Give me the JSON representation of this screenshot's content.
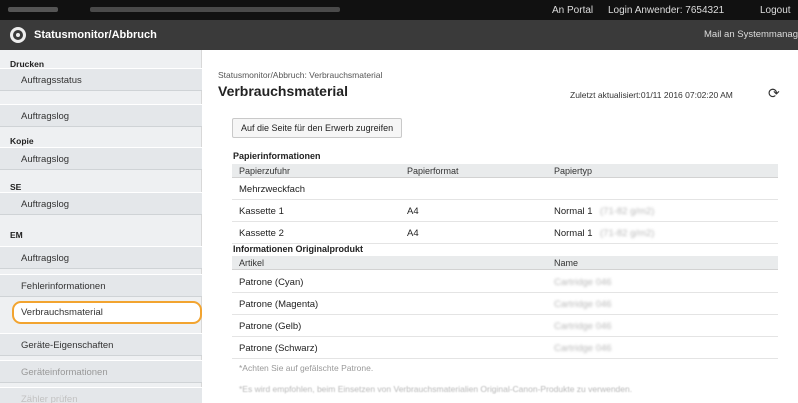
{
  "topbar": {
    "portal": "An Portal",
    "login": "Login Anwender:  7654321",
    "logout": "Logout"
  },
  "header": {
    "title": "Statusmonitor/Abbruch",
    "mail": "Mail an Systemmanager"
  },
  "sidebar": {
    "sections": [
      {
        "label": "Drucken",
        "items": [
          "Auftragsstatus",
          "Auftragslog"
        ]
      },
      {
        "label": "Kopie",
        "items": [
          "Auftragslog"
        ]
      },
      {
        "label": "SE",
        "items": [
          "Auftragslog"
        ]
      },
      {
        "label": "EM",
        "items": [
          "Auftragslog"
        ]
      }
    ],
    "extra_items": [
      "Fehlerinformationen",
      "Verbrauchsmaterial",
      "Geräte-Eigenschaften",
      "Geräteinformationen",
      "Zähler prüfen"
    ],
    "active_item": "Verbrauchsmaterial"
  },
  "main": {
    "breadcrumb": "Statusmonitor/Abbruch: Verbrauchsmaterial",
    "title": "Verbrauchsmaterial",
    "updated": "Zuletzt aktualisiert:01/11 2016 07:02:20 AM",
    "purchase_button": "Auf die Seite für den Erwerb zugreifen",
    "paper": {
      "heading": "Papierinformationen",
      "columns": [
        "Papierzufuhr",
        "Papierformat",
        "Papiertyp"
      ],
      "rows": [
        [
          "Mehrzweckfach",
          "",
          ""
        ],
        [
          "Kassette 1",
          "A4",
          "Normal 1"
        ],
        [
          "Kassette 2",
          "A4",
          "Normal 1"
        ]
      ],
      "type_detail": "(71-82 g/m2)"
    },
    "original": {
      "heading": "Informationen Originalprodukt",
      "columns": [
        "Artikel",
        "Name"
      ],
      "rows": [
        [
          "Patrone (Cyan)",
          "Cartridge 046"
        ],
        [
          "Patrone (Magenta)",
          "Cartridge 046"
        ],
        [
          "Patrone (Gelb)",
          "Cartridge 046"
        ],
        [
          "Patrone (Schwarz)",
          "Cartridge 046"
        ]
      ]
    },
    "note1": "*Achten Sie auf gefälschte Patrone.",
    "note2": "*Es wird empfohlen, beim Einsetzen von Verbrauchsmaterialien Original-Canon-Produkte zu verwenden."
  }
}
